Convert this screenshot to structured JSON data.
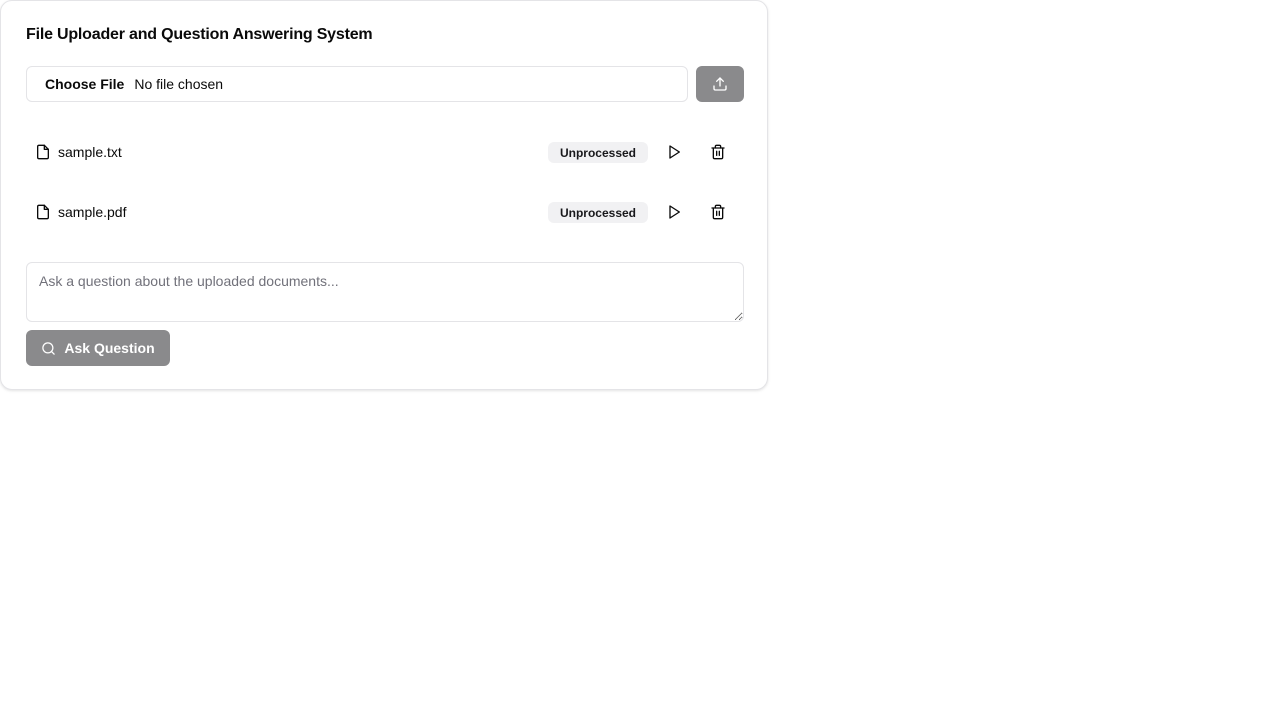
{
  "header": {
    "title": "File Uploader and Question Answering System"
  },
  "upload": {
    "choose_label": "Choose File",
    "file_status": "No file chosen",
    "upload_icon": "upload-icon",
    "button_color": "#8a8a8c"
  },
  "files": [
    {
      "name": "sample.txt",
      "status": "Unprocessed",
      "icon": "file-icon"
    },
    {
      "name": "sample.pdf",
      "status": "Unprocessed",
      "icon": "file-icon"
    }
  ],
  "question": {
    "placeholder": "Ask a question about the uploaded documents...",
    "value": ""
  },
  "ask": {
    "label": "Ask Question",
    "icon": "search-icon"
  }
}
